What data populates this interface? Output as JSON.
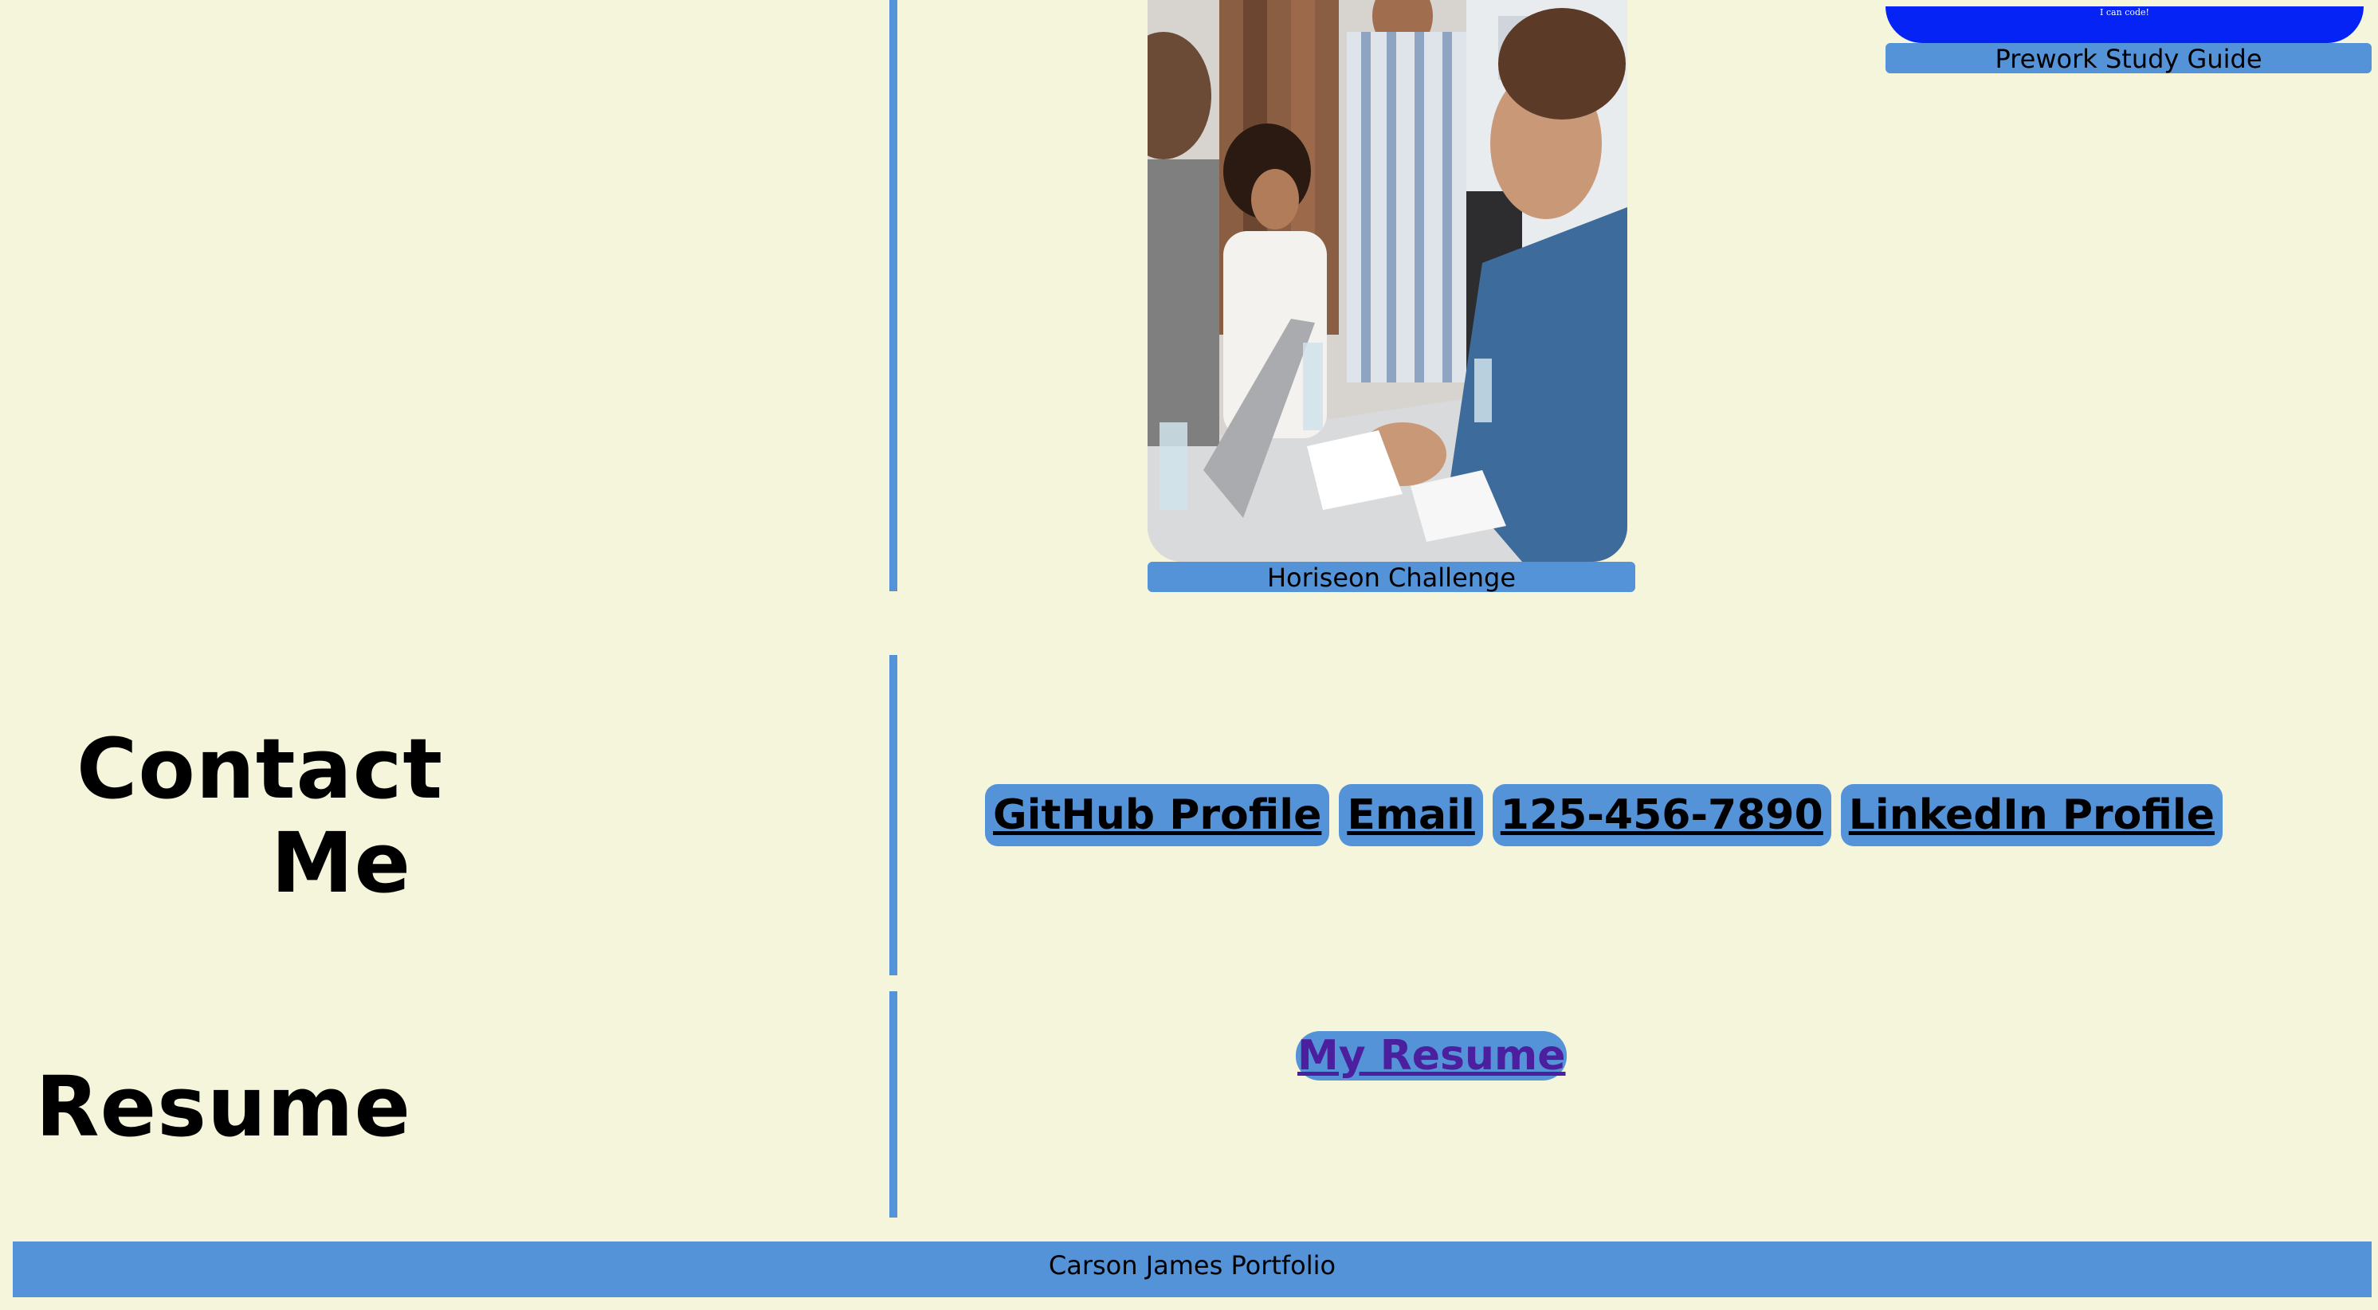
{
  "portfolio": {
    "horiseon": {
      "label": "Horiseon Challenge"
    },
    "prework": {
      "image_text": "I can code!",
      "label": "Prework Study Guide"
    }
  },
  "contact": {
    "title": "Contact Me",
    "links": [
      {
        "label": "GitHub Profile"
      },
      {
        "label": "Email"
      },
      {
        "label": "125-456-7890"
      },
      {
        "label": "LinkedIn Profile"
      }
    ]
  },
  "resume": {
    "title": "Resume",
    "link_label": "My Resume"
  },
  "footer": {
    "text": "Carson James Portfolio"
  },
  "colors": {
    "background": "#f5f5dc",
    "accent": "#5593d9",
    "prework_banner": "#0523f5",
    "visited_link": "#4b1f9e"
  }
}
